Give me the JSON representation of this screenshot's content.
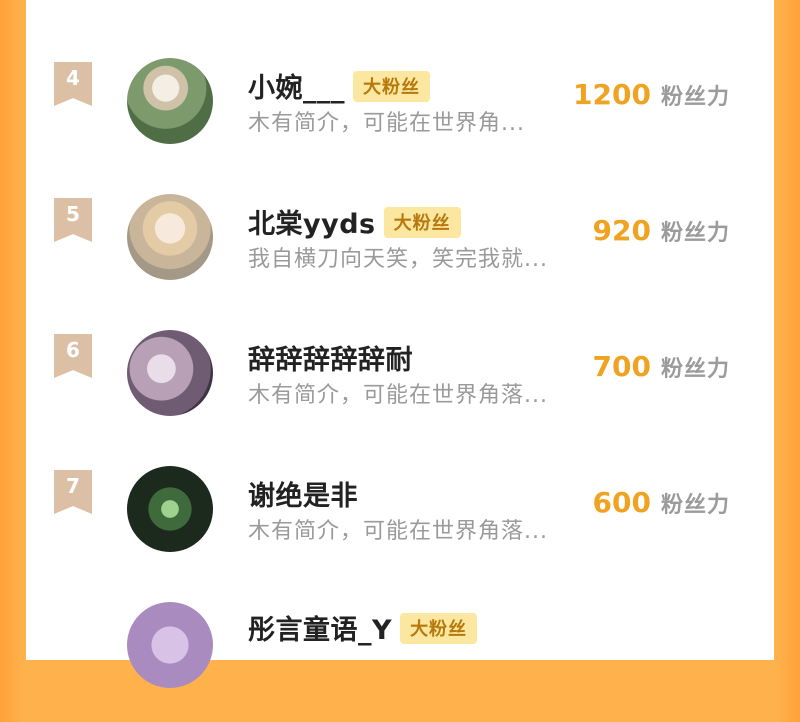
{
  "list": {
    "rows": [
      {
        "rank": "4",
        "name": "小婉___",
        "tag": "大粉丝",
        "bio": "木有简介，可能在世界角...",
        "fans": "1200",
        "unit": "粉丝力"
      },
      {
        "rank": "5",
        "name": "北棠yyds",
        "tag": "大粉丝",
        "bio": "我自横刀向天笑，笑完我就...",
        "fans": "920",
        "unit": "粉丝力"
      },
      {
        "rank": "6",
        "name": "辞辞辞辞辞耐",
        "tag": "",
        "bio": "木有简介，可能在世界角落...",
        "fans": "700",
        "unit": "粉丝力"
      },
      {
        "rank": "7",
        "name": "谢绝是非",
        "tag": "",
        "bio": "木有简介，可能在世界角落...",
        "fans": "600",
        "unit": "粉丝力"
      },
      {
        "rank": "",
        "name": "彤言童语_Y",
        "tag": "大粉丝",
        "bio": "",
        "fans": "",
        "unit": ""
      }
    ]
  },
  "colors": {
    "accent": "#f0a322",
    "background": "#ffb24c",
    "badge": "#dcc0a6",
    "tag_bg": "#fbe7a0"
  },
  "icons": [
    "rank-ribbon-icon"
  ]
}
